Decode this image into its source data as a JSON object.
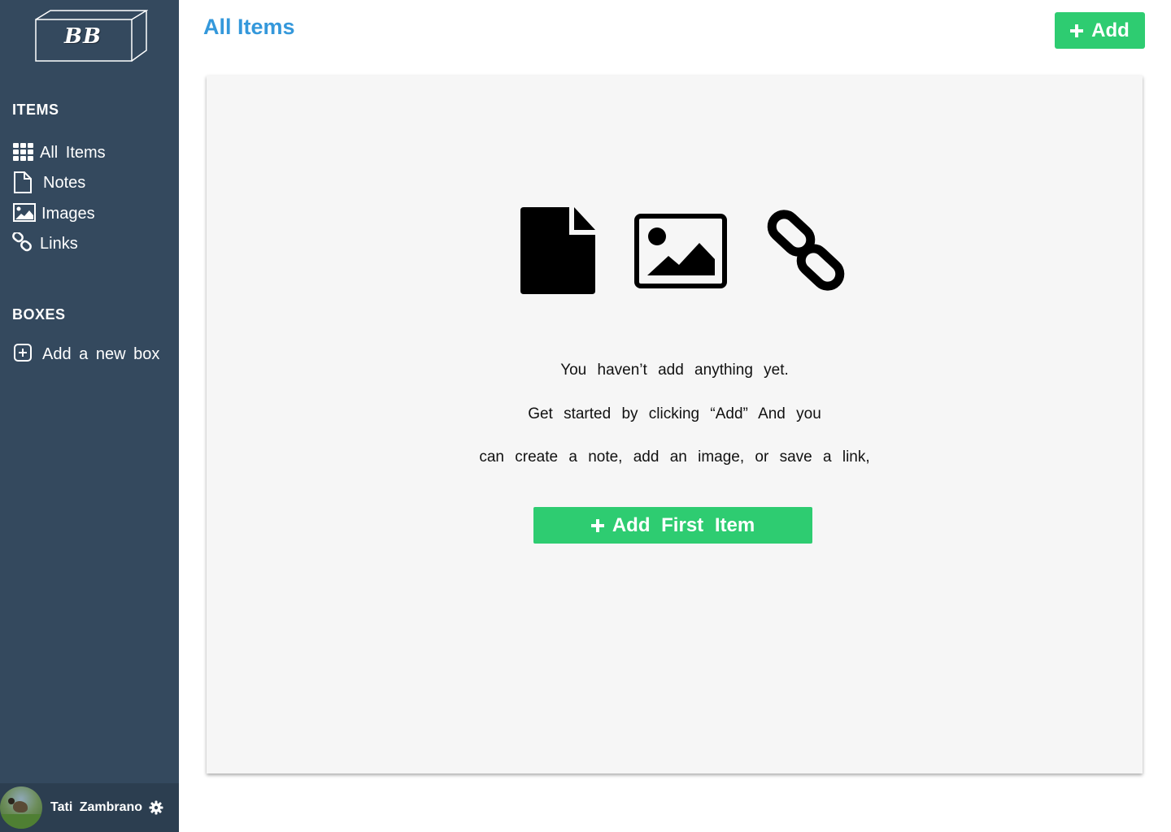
{
  "brand": {
    "logo_text": "BB"
  },
  "sidebar": {
    "items_heading": "ITEMS",
    "items": [
      {
        "label": "All  Items",
        "icon": "grid-icon"
      },
      {
        "label": "Notes",
        "icon": "file-icon"
      },
      {
        "label": "Images",
        "icon": "image-icon"
      },
      {
        "label": "Links",
        "icon": "link-icon"
      }
    ],
    "boxes_heading": "BOXES",
    "add_box_label": "Add a new box",
    "user": {
      "name": "Tati Zambrano"
    }
  },
  "header": {
    "title": "All Items",
    "add_label": "Add"
  },
  "empty_state": {
    "line1": "You haven’t add anything yet.",
    "line2": "Get started by clicking “Add” And you",
    "line3": "can create a note, add an image, or save a link,",
    "button_label": "Add First Item",
    "icons": [
      "file-icon",
      "image-icon",
      "link-icon"
    ]
  },
  "colors": {
    "sidebar_bg": "#34495e",
    "profile_bg": "#2c3e50",
    "accent_green": "#2ecc71",
    "title_blue": "#3498db",
    "panel_bg": "#f6f6f6"
  }
}
